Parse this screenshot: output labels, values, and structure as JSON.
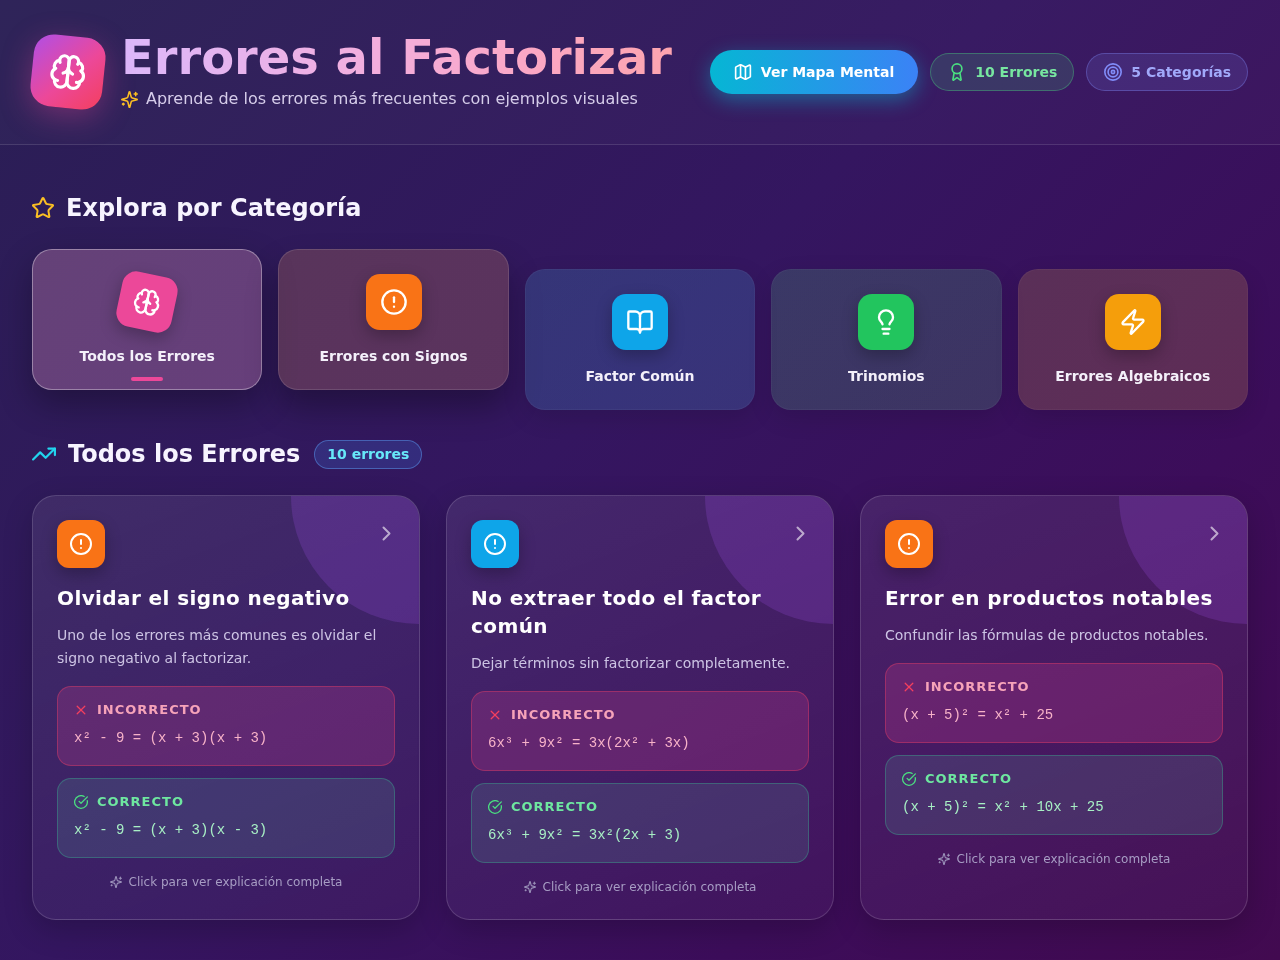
{
  "header": {
    "title": "Errores al Factorizar",
    "subtitle": "Aprende de los errores más frecuentes con ejemplos visuales",
    "button": "Ver Mapa Mental",
    "badges": [
      {
        "label": "10 Errores",
        "color": "#4ade80"
      },
      {
        "label": "5 Categorías",
        "color": "#818cf8"
      }
    ]
  },
  "categories_section": {
    "title": "Explora por Categoría",
    "categories": [
      {
        "label": "Todos los Errores",
        "color": "#ec4899",
        "selected": true,
        "raised": true
      },
      {
        "label": "Errores con Signos",
        "color": "#f97316",
        "selected": false,
        "raised": true
      },
      {
        "label": "Factor Común",
        "color": "#0ea5e9",
        "selected": false,
        "raised": false
      },
      {
        "label": "Trinomios",
        "color": "#22c55e",
        "selected": false,
        "raised": false
      },
      {
        "label": "Errores Algebraicos",
        "color": "#f59e0b",
        "selected": false,
        "raised": false
      }
    ]
  },
  "errors_section": {
    "title": "Todos los Errores",
    "count": "10 errores",
    "cards": [
      {
        "title": "Olvidar el signo negativo",
        "description": "Uno de los errores más comunes es olvidar el signo negativo al factorizar.",
        "color": "#f97316",
        "examples": [
          {
            "kind": "incorrect",
            "label": "INCORRECTO",
            "formula": "x² - 9 = (x + 3)(x + 3)"
          },
          {
            "kind": "correct",
            "label": "CORRECTO",
            "formula": "x² - 9 = (x + 3)(x - 3)"
          }
        ],
        "hint": "Click para ver explicación completa"
      },
      {
        "title": "No extraer todo el factor común",
        "description": "Dejar términos sin factorizar completamente.",
        "color": "#0ea5e9",
        "examples": [
          {
            "kind": "incorrect",
            "label": "INCORRECTO",
            "formula": "6x³ + 9x² = 3x(2x² + 3x)"
          },
          {
            "kind": "correct",
            "label": "CORRECTO",
            "formula": "6x³ + 9x² = 3x²(2x + 3)"
          }
        ],
        "hint": "Click para ver explicación completa"
      },
      {
        "title": "Error en productos notables",
        "description": "Confundir las fórmulas de productos notables.",
        "color": "#f97316",
        "examples": [
          {
            "kind": "incorrect",
            "label": "INCORRECTO",
            "formula": "(x + 5)² = x² + 25"
          },
          {
            "kind": "correct",
            "label": "CORRECTO",
            "formula": "(x + 5)² = x² + 10x + 25"
          }
        ],
        "hint": "Click para ver explicación completa"
      }
    ]
  }
}
